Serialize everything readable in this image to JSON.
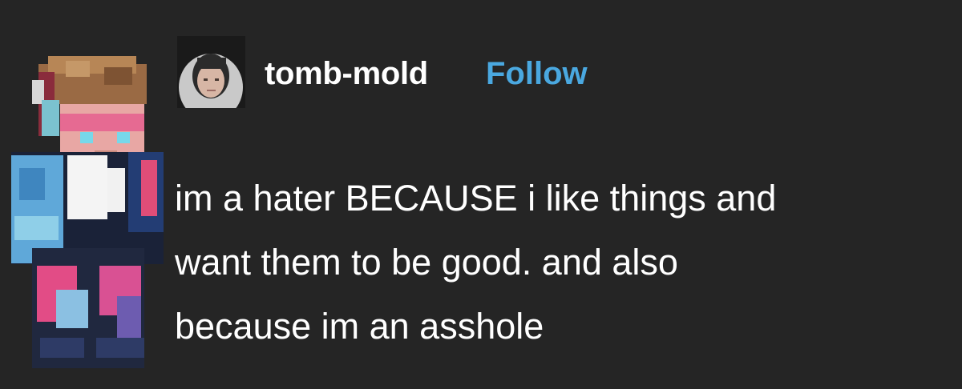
{
  "post": {
    "author": "tomb-mold",
    "follow_label": "Follow",
    "text_lines": [
      "im a hater BECAUSE i like things and",
      "want them to be good. and also",
      "because im an asshole"
    ]
  },
  "icons": {
    "avatar": "user-avatar-photo",
    "skin": "pixel-character-skin"
  },
  "colors": {
    "background": "#252525",
    "text": "#ffffff",
    "follow": "#4aa8e0"
  }
}
